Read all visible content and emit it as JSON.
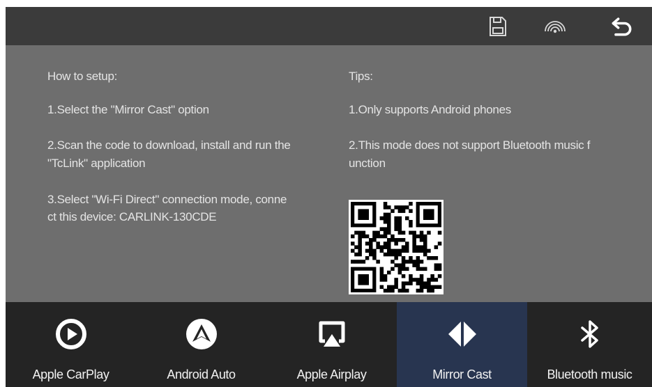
{
  "setup": {
    "heading": "How to setup:",
    "step1": "1.Select the \"Mirror Cast\" option",
    "step2_line1": "2.Scan the code to download, install and run the",
    "step2_line2": "\"TcLink\" application",
    "step3_line1": "3.Select \"Wi-Fi Direct\" connection mode, conne",
    "step3_line2": "ct this device: CARLINK-130CDE"
  },
  "tips": {
    "heading": "Tips:",
    "tip1": "1.Only supports Android phones",
    "tip2_line1": "2.This mode does not support Bluetooth music f",
    "tip2_line2": "unction"
  },
  "toolbar": {
    "icons": [
      "save-icon",
      "wireless-signal-icon",
      "back-icon"
    ]
  },
  "dock": {
    "items": [
      {
        "label": "Apple CarPlay",
        "icon": "carplay-icon"
      },
      {
        "label": "Android Auto",
        "icon": "android-auto-icon"
      },
      {
        "label": "Apple Airplay",
        "icon": "airplay-icon"
      },
      {
        "label": "Mirror Cast",
        "icon": "mirror-cast-icon",
        "selected": true
      },
      {
        "label": "Bluetooth music",
        "icon": "bluetooth-icon"
      }
    ]
  },
  "colors": {
    "screen_bg": "#6e6e6e",
    "topbar_bg": "#3b3b3b",
    "dock_bg": "#242424",
    "dock_active_bg": "#283550",
    "text": "#e4e4e4"
  }
}
